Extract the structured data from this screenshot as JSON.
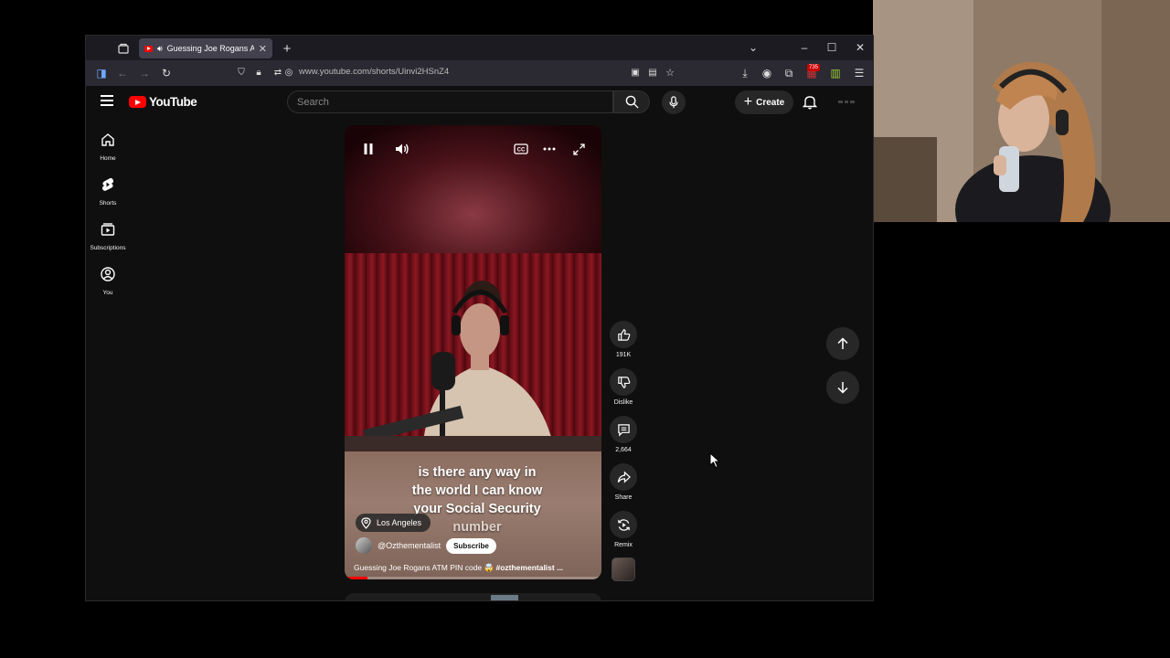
{
  "browser": {
    "tab_title": "Guessing Joe Rogans ATM",
    "url": "www.youtube.com/shorts/Uinvi2HSnZ4",
    "extension_badge": "735"
  },
  "youtube": {
    "logo_text": "YouTube",
    "search_placeholder": "Search",
    "create_label": "Create",
    "sidebar": {
      "items": [
        {
          "label": "Home",
          "icon": "home-icon"
        },
        {
          "label": "Shorts",
          "icon": "shorts-icon"
        },
        {
          "label": "Subscriptions",
          "icon": "subscriptions-icon"
        },
        {
          "label": "You",
          "icon": "you-icon"
        }
      ]
    }
  },
  "short": {
    "caption_lines": [
      "is there any way in",
      "the world I can know",
      "your Social Security",
      "number"
    ],
    "location": "Los Angeles",
    "channel": "@Ozthementalist",
    "subscribe_label": "Subscribe",
    "title_text": "Guessing Joe Rogans ATM PIN code 🤯",
    "title_hashtag": "#ozthementalist ...",
    "progress_fraction": 0.09
  },
  "actions": {
    "likes": "191K",
    "dislike": "Dislike",
    "comments": "2,664",
    "share": "Share",
    "remix": "Remix"
  },
  "colors": {
    "accent": "#ff0000",
    "background": "#0f0f0f",
    "button_bg": "#272727"
  }
}
